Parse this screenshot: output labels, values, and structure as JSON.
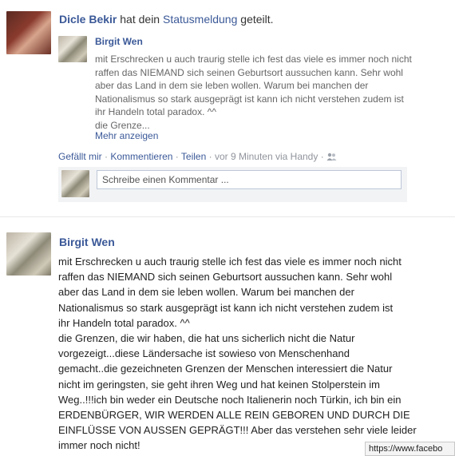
{
  "share": {
    "actor": "Dicle Bekir",
    "action_prefix": "hat dein",
    "action_link": "Statusmeldung",
    "action_suffix": "geteilt.",
    "inner": {
      "author": "Birgit Wen",
      "text_lines": [
        "mit Erschrecken u auch traurig stelle ich fest das viele es immer noch nicht",
        "raffen das NIEMAND sich seinen Geburtsort aussuchen kann. Sehr wohl",
        "aber das Land in dem sie leben wollen. Warum bei manchen der",
        "Nationalismus so stark ausgeprägt ist kann ich nicht verstehen zudem ist",
        "ihr Handeln total paradox. ^^",
        "die Grenze..."
      ],
      "more_label": "Mehr anzeigen"
    },
    "actions": {
      "like": "Gefällt mir",
      "sep": "·",
      "comment": "Kommentieren",
      "share": "Teilen",
      "time": "vor 9 Minuten via Handy"
    },
    "comment_placeholder": "Schreibe einen Kommentar ..."
  },
  "post": {
    "author": "Birgit Wen",
    "text_lines": [
      "mit Erschrecken u auch traurig stelle ich fest das viele es immer noch nicht",
      "raffen das NIEMAND sich seinen Geburtsort aussuchen kann. Sehr wohl",
      "aber das Land in dem sie leben wollen. Warum bei manchen der",
      "Nationalismus so stark ausgeprägt ist kann ich nicht verstehen zudem ist",
      "ihr Handeln total paradox. ^^",
      "die Grenzen, die wir haben, die hat uns sicherlich nicht die Natur",
      "vorgezeigt...diese Ländersache ist sowieso von Menschenhand",
      "gemacht..die gezeichneten Grenzen der Menschen interessiert die Natur",
      "nicht im geringsten, sie geht ihren Weg und hat keinen Stolperstein im",
      "Weg..!!!ich bin weder ein Deutsche noch Italienerin noch Türkin, ich bin ein",
      "ERDENBÜRGER, WIR WERDEN ALLE REIN GEBOREN UND DURCH DIE",
      "EINFLÜSSE VON AUSSEN GEPRÄGT!!! Aber das verstehen sehr viele leider",
      "immer noch nicht!"
    ]
  },
  "status_url": "https://www.facebo"
}
